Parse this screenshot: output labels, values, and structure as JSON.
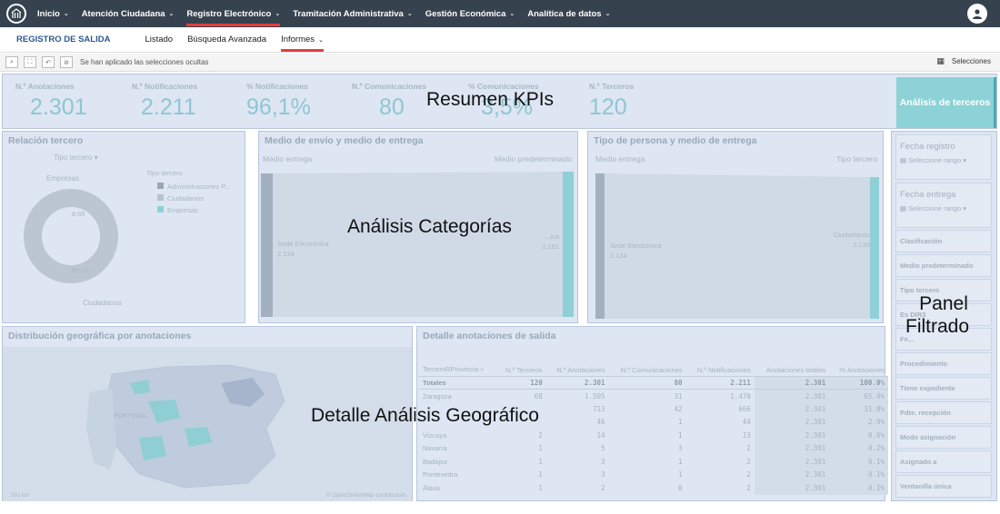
{
  "topnav": {
    "items": [
      {
        "label": "Inicio",
        "active": false
      },
      {
        "label": "Atención Ciudadana",
        "active": false
      },
      {
        "label": "Registro Electrónico",
        "active": true
      },
      {
        "label": "Tramitación Administrativa",
        "active": false
      },
      {
        "label": "Gestión Económica",
        "active": false
      },
      {
        "label": "Analítica de datos",
        "active": false
      }
    ]
  },
  "subnav": {
    "title": "REGISTRO DE SALIDA",
    "items": [
      {
        "label": "Listado"
      },
      {
        "label": "Búsqueda Avanzada"
      },
      {
        "label": "Informes"
      }
    ]
  },
  "selbar": {
    "message": "Se han aplicado las selecciones ocultas",
    "selections_label": "Selecciones"
  },
  "kpis": {
    "items": [
      {
        "label": "N.º Anotaciones",
        "value": "2.301"
      },
      {
        "label": "N.º Notificaciones",
        "value": "2.211"
      },
      {
        "label": "% Notificaciones",
        "value": "96,1%"
      },
      {
        "label": "N.º Comunicaciones",
        "value": "80"
      },
      {
        "label": "% Comunicaciones",
        "value": "3,5%"
      },
      {
        "label": "N.º Terceros",
        "value": "120"
      }
    ],
    "button_label": "Análisis de terceros",
    "overlay": "Resumen KPIs"
  },
  "relacion": {
    "title": "Relación tercero",
    "dropdown": "Tipo tercero",
    "legend_title": "Tipo tercero",
    "legend": [
      {
        "label": "Administraciones P...",
        "color": "#9aa6b4"
      },
      {
        "label": "Ciudadanos",
        "color": "#b9c3d0"
      },
      {
        "label": "Empresas",
        "color": "#8fd0d6"
      }
    ],
    "donut_label_top": "Empresas",
    "donut_label_bottom": "Ciudadanos",
    "value_a": "8.65",
    "value_b": "99.26"
  },
  "envio": {
    "title": "Medio de envío y medio de entrega",
    "left_label": "Medio entrega",
    "right_label": "Medio predeterminado",
    "node_label": "Sede Electrónica",
    "node_value": "2.134",
    "right_node_label": "...ica",
    "right_node_value": "2.151"
  },
  "persona": {
    "title": "Tipo de persona y medio de entrega",
    "left_label": "Medio entrega",
    "right_label": "Tipo tercero",
    "node_label": "Sede Electrónica",
    "node_value": "2.134",
    "right_node_label": "Ciudadanos",
    "right_node_value": "2.139"
  },
  "categorias_overlay": "Análisis Categorías",
  "geo": {
    "title": "Distribución geográfica por anotaciones",
    "scale": "200 km",
    "credits": "© OpenStreetMap contributors",
    "country_label": "PORTUGAL",
    "overlay": "Detalle Análisis Geográfico"
  },
  "detalle": {
    "title": "Detalle anotaciones de salida",
    "columns": [
      "TerceroRProvincia",
      "N.º Terceros",
      "N.º Anotaciones",
      "N.º Comunicaciones",
      "N.º Notificaciones",
      "Anotaciones totales",
      "% Anotaciones"
    ],
    "totals": [
      "Totales",
      "120",
      "2.301",
      "80",
      "2.211",
      "2.301",
      "100.0%"
    ],
    "rows": [
      [
        "Zaragoza",
        "68",
        "1.505",
        "31",
        "1.470",
        "2.301",
        "65.4%"
      ],
      [
        "",
        "",
        "713",
        "42",
        "666",
        "2.301",
        "31.0%"
      ],
      [
        "",
        "",
        "46",
        "1",
        "44",
        "2.301",
        "2.0%"
      ],
      [
        "Vizcaya",
        "2",
        "14",
        "1",
        "13",
        "2.301",
        "0.6%"
      ],
      [
        "Navarra",
        "1",
        "5",
        "3",
        "2",
        "2.301",
        "0.2%"
      ],
      [
        "Badajoz",
        "1",
        "3",
        "1",
        "2",
        "2.301",
        "0.1%"
      ],
      [
        "Pontevedra",
        "1",
        "3",
        "1",
        "2",
        "2.301",
        "0.1%"
      ],
      [
        "Álava",
        "1",
        "2",
        "0",
        "2",
        "2.301",
        "0.1%"
      ]
    ]
  },
  "filtros": {
    "items": [
      {
        "label": "Fecha registro",
        "sub": "Seleccione rango",
        "big": true
      },
      {
        "label": "Fecha entrega",
        "sub": "Seleccione rango",
        "big": true
      },
      {
        "label": "Clasificación"
      },
      {
        "label": "Medio predeterminado"
      },
      {
        "label": "Tipo tercero"
      },
      {
        "label": "Es DIR3"
      },
      {
        "label": "Fe..."
      },
      {
        "label": "Procedimiento"
      },
      {
        "label": "Tiene expediente"
      },
      {
        "label": "Pdte. recepción"
      },
      {
        "label": "Modo asignación"
      },
      {
        "label": "Asignado a"
      },
      {
        "label": "Ventanilla única"
      }
    ],
    "overlay_line1": "Panel",
    "overlay_line2": "Filtrado"
  }
}
